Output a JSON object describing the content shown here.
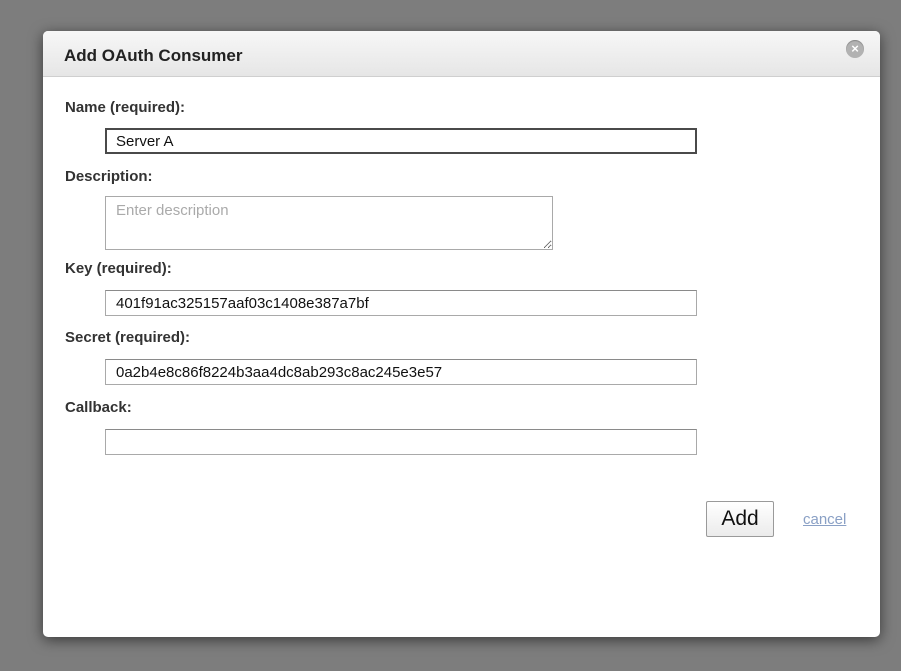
{
  "dialog": {
    "title": "Add OAuth Consumer",
    "close_icon": "close-icon"
  },
  "form": {
    "name": {
      "label": "Name (required):",
      "value": "Server A"
    },
    "description": {
      "label": "Description:",
      "value": "",
      "placeholder": "Enter description"
    },
    "key": {
      "label": "Key (required):",
      "value": "401f91ac325157aaf03c1408e387a7bf"
    },
    "secret": {
      "label": "Secret (required):",
      "value": "0a2b4e8c86f8224b3aa4dc8ab293c8ac245e3e57"
    },
    "callback": {
      "label": "Callback:",
      "value": ""
    }
  },
  "actions": {
    "add_label": "Add",
    "cancel_label": "cancel"
  },
  "colors": {
    "overlay": "#7d7d7d",
    "link": "#8aa0c5",
    "close_button": "#b2b2b2"
  }
}
